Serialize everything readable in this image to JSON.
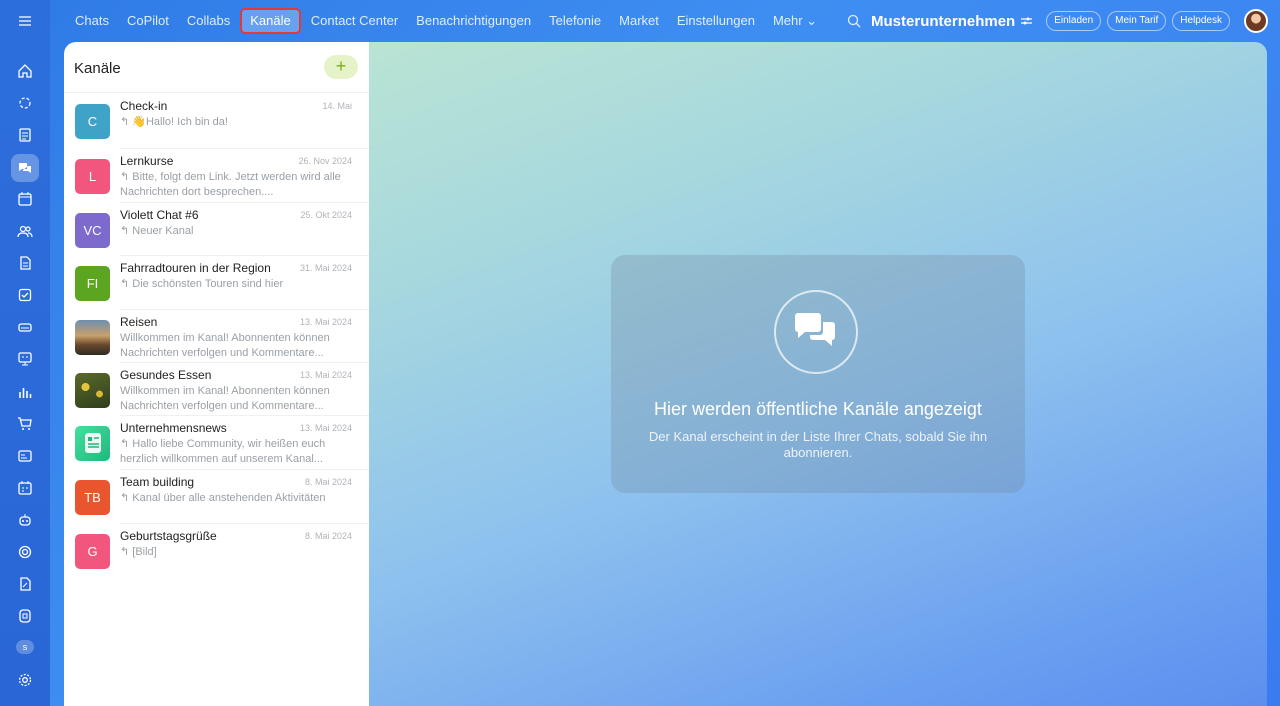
{
  "nav": {
    "items": [
      "Chats",
      "CoPilot",
      "Collabs",
      "Kanäle",
      "Contact Center",
      "Benachrichtigungen",
      "Telefonie",
      "Market",
      "Einstellungen",
      "Mehr ⌄"
    ],
    "active": "Kanäle"
  },
  "header": {
    "company": "Musterunternehmen",
    "invite": "Einladen",
    "tariff": "Mein Tarif",
    "helpdesk": "Helpdesk"
  },
  "rail": {
    "user_initial": "s"
  },
  "panel": {
    "title": "Kanäle",
    "add_label": "+",
    "channels": [
      {
        "avatar": "C",
        "color": "#3fa3c8",
        "title": "Check-in",
        "date": "14. Mai",
        "message": "↰ 👋Hallo! Ich bin da!"
      },
      {
        "avatar": "L",
        "color": "#f2567e",
        "title": "Lernkurse",
        "date": "26. Nov 2024",
        "message": "↰ Bitte, folgt dem Link. Jetzt werden wird alle Nachrichten dort besprechen...."
      },
      {
        "avatar": "VC",
        "color": "#7e6acc",
        "title": "Violett Chat #6",
        "date": "25. Okt 2024",
        "message": "↰ Neuer Kanal"
      },
      {
        "avatar": "FI",
        "color": "#5ba520",
        "title": "Fahrradtouren in der Region",
        "date": "31. Mai 2024",
        "message": "↰ Die schönsten Touren sind hier"
      },
      {
        "avatar": "",
        "color": "#8a6a4a",
        "title": "Reisen",
        "date": "13. Mai 2024",
        "message": "Willkommen im Kanal! Abonnenten können Nachrichten verfolgen und Kommentare..."
      },
      {
        "avatar": "",
        "color": "#7d8a3a",
        "title": "Gesundes Essen",
        "date": "13. Mai 2024",
        "message": "Willkommen im Kanal! Abonnenten können Nachrichten verfolgen und Kommentare..."
      },
      {
        "avatar": "",
        "color": "#2fd08a",
        "title": "Unternehmensnews",
        "date": "13. Mai 2024",
        "message": "↰ Hallo liebe Community, wir heißen euch herzlich willkommen auf unserem Kanal..."
      },
      {
        "avatar": "TB",
        "color": "#e8552f",
        "title": "Team building",
        "date": "8. Mai 2024",
        "message": "↰ Kanal über alle anstehenden Aktivitäten"
      },
      {
        "avatar": "G",
        "color": "#f2567e",
        "title": "Geburtstagsgrüße",
        "date": "8. Mai 2024",
        "message": "↰ [Bild]"
      }
    ]
  },
  "main": {
    "title": "Hier werden öffentliche Kanäle angezeigt",
    "subtitle": "Der Kanal erscheint in der Liste Ihrer Chats, sobald Sie ihn abonnieren."
  },
  "icons": [
    "menu-icon",
    "home-icon",
    "copilot-icon",
    "feed-icon",
    "chat-icon",
    "calendar-icon",
    "team-icon",
    "docs-icon",
    "tasks-icon",
    "drive-icon",
    "crm-icon",
    "analytics-icon",
    "shop-icon",
    "contacts-icon",
    "booking-icon",
    "robot-icon",
    "goals-icon",
    "sign-icon",
    "knowledge-icon",
    "settings-icon",
    "search-icon",
    "add-channel-icon",
    "chat-bubbles-icon"
  ]
}
